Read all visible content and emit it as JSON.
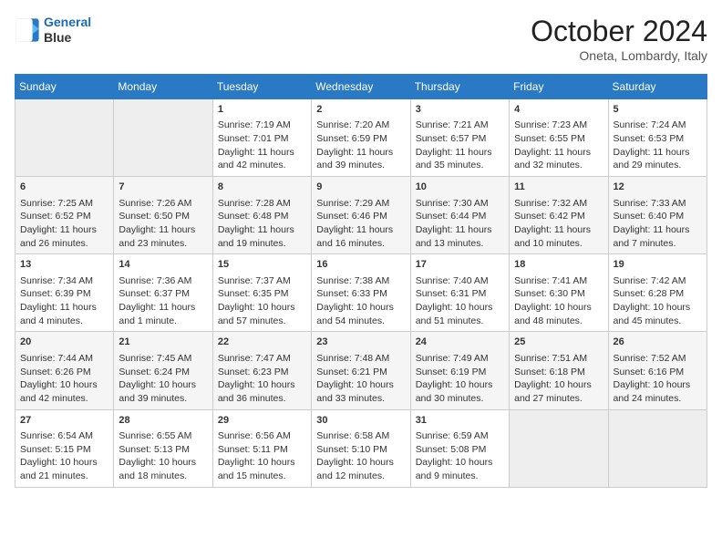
{
  "header": {
    "logo_line1": "General",
    "logo_line2": "Blue",
    "month": "October 2024",
    "location": "Oneta, Lombardy, Italy"
  },
  "weekdays": [
    "Sunday",
    "Monday",
    "Tuesday",
    "Wednesday",
    "Thursday",
    "Friday",
    "Saturday"
  ],
  "weeks": [
    [
      {
        "day": "",
        "empty": true
      },
      {
        "day": "",
        "empty": true
      },
      {
        "day": "1",
        "lines": [
          "Sunrise: 7:19 AM",
          "Sunset: 7:01 PM",
          "Daylight: 11 hours",
          "and 42 minutes."
        ]
      },
      {
        "day": "2",
        "lines": [
          "Sunrise: 7:20 AM",
          "Sunset: 6:59 PM",
          "Daylight: 11 hours",
          "and 39 minutes."
        ]
      },
      {
        "day": "3",
        "lines": [
          "Sunrise: 7:21 AM",
          "Sunset: 6:57 PM",
          "Daylight: 11 hours",
          "and 35 minutes."
        ]
      },
      {
        "day": "4",
        "lines": [
          "Sunrise: 7:23 AM",
          "Sunset: 6:55 PM",
          "Daylight: 11 hours",
          "and 32 minutes."
        ]
      },
      {
        "day": "5",
        "lines": [
          "Sunrise: 7:24 AM",
          "Sunset: 6:53 PM",
          "Daylight: 11 hours",
          "and 29 minutes."
        ]
      }
    ],
    [
      {
        "day": "6",
        "lines": [
          "Sunrise: 7:25 AM",
          "Sunset: 6:52 PM",
          "Daylight: 11 hours",
          "and 26 minutes."
        ]
      },
      {
        "day": "7",
        "lines": [
          "Sunrise: 7:26 AM",
          "Sunset: 6:50 PM",
          "Daylight: 11 hours",
          "and 23 minutes."
        ]
      },
      {
        "day": "8",
        "lines": [
          "Sunrise: 7:28 AM",
          "Sunset: 6:48 PM",
          "Daylight: 11 hours",
          "and 19 minutes."
        ]
      },
      {
        "day": "9",
        "lines": [
          "Sunrise: 7:29 AM",
          "Sunset: 6:46 PM",
          "Daylight: 11 hours",
          "and 16 minutes."
        ]
      },
      {
        "day": "10",
        "lines": [
          "Sunrise: 7:30 AM",
          "Sunset: 6:44 PM",
          "Daylight: 11 hours",
          "and 13 minutes."
        ]
      },
      {
        "day": "11",
        "lines": [
          "Sunrise: 7:32 AM",
          "Sunset: 6:42 PM",
          "Daylight: 11 hours",
          "and 10 minutes."
        ]
      },
      {
        "day": "12",
        "lines": [
          "Sunrise: 7:33 AM",
          "Sunset: 6:40 PM",
          "Daylight: 11 hours",
          "and 7 minutes."
        ]
      }
    ],
    [
      {
        "day": "13",
        "lines": [
          "Sunrise: 7:34 AM",
          "Sunset: 6:39 PM",
          "Daylight: 11 hours",
          "and 4 minutes."
        ]
      },
      {
        "day": "14",
        "lines": [
          "Sunrise: 7:36 AM",
          "Sunset: 6:37 PM",
          "Daylight: 11 hours",
          "and 1 minute."
        ]
      },
      {
        "day": "15",
        "lines": [
          "Sunrise: 7:37 AM",
          "Sunset: 6:35 PM",
          "Daylight: 10 hours",
          "and 57 minutes."
        ]
      },
      {
        "day": "16",
        "lines": [
          "Sunrise: 7:38 AM",
          "Sunset: 6:33 PM",
          "Daylight: 10 hours",
          "and 54 minutes."
        ]
      },
      {
        "day": "17",
        "lines": [
          "Sunrise: 7:40 AM",
          "Sunset: 6:31 PM",
          "Daylight: 10 hours",
          "and 51 minutes."
        ]
      },
      {
        "day": "18",
        "lines": [
          "Sunrise: 7:41 AM",
          "Sunset: 6:30 PM",
          "Daylight: 10 hours",
          "and 48 minutes."
        ]
      },
      {
        "day": "19",
        "lines": [
          "Sunrise: 7:42 AM",
          "Sunset: 6:28 PM",
          "Daylight: 10 hours",
          "and 45 minutes."
        ]
      }
    ],
    [
      {
        "day": "20",
        "lines": [
          "Sunrise: 7:44 AM",
          "Sunset: 6:26 PM",
          "Daylight: 10 hours",
          "and 42 minutes."
        ]
      },
      {
        "day": "21",
        "lines": [
          "Sunrise: 7:45 AM",
          "Sunset: 6:24 PM",
          "Daylight: 10 hours",
          "and 39 minutes."
        ]
      },
      {
        "day": "22",
        "lines": [
          "Sunrise: 7:47 AM",
          "Sunset: 6:23 PM",
          "Daylight: 10 hours",
          "and 36 minutes."
        ]
      },
      {
        "day": "23",
        "lines": [
          "Sunrise: 7:48 AM",
          "Sunset: 6:21 PM",
          "Daylight: 10 hours",
          "and 33 minutes."
        ]
      },
      {
        "day": "24",
        "lines": [
          "Sunrise: 7:49 AM",
          "Sunset: 6:19 PM",
          "Daylight: 10 hours",
          "and 30 minutes."
        ]
      },
      {
        "day": "25",
        "lines": [
          "Sunrise: 7:51 AM",
          "Sunset: 6:18 PM",
          "Daylight: 10 hours",
          "and 27 minutes."
        ]
      },
      {
        "day": "26",
        "lines": [
          "Sunrise: 7:52 AM",
          "Sunset: 6:16 PM",
          "Daylight: 10 hours",
          "and 24 minutes."
        ]
      }
    ],
    [
      {
        "day": "27",
        "lines": [
          "Sunrise: 6:54 AM",
          "Sunset: 5:15 PM",
          "Daylight: 10 hours",
          "and 21 minutes."
        ]
      },
      {
        "day": "28",
        "lines": [
          "Sunrise: 6:55 AM",
          "Sunset: 5:13 PM",
          "Daylight: 10 hours",
          "and 18 minutes."
        ]
      },
      {
        "day": "29",
        "lines": [
          "Sunrise: 6:56 AM",
          "Sunset: 5:11 PM",
          "Daylight: 10 hours",
          "and 15 minutes."
        ]
      },
      {
        "day": "30",
        "lines": [
          "Sunrise: 6:58 AM",
          "Sunset: 5:10 PM",
          "Daylight: 10 hours",
          "and 12 minutes."
        ]
      },
      {
        "day": "31",
        "lines": [
          "Sunrise: 6:59 AM",
          "Sunset: 5:08 PM",
          "Daylight: 10 hours",
          "and 9 minutes."
        ]
      },
      {
        "day": "",
        "empty": true
      },
      {
        "day": "",
        "empty": true
      }
    ]
  ]
}
